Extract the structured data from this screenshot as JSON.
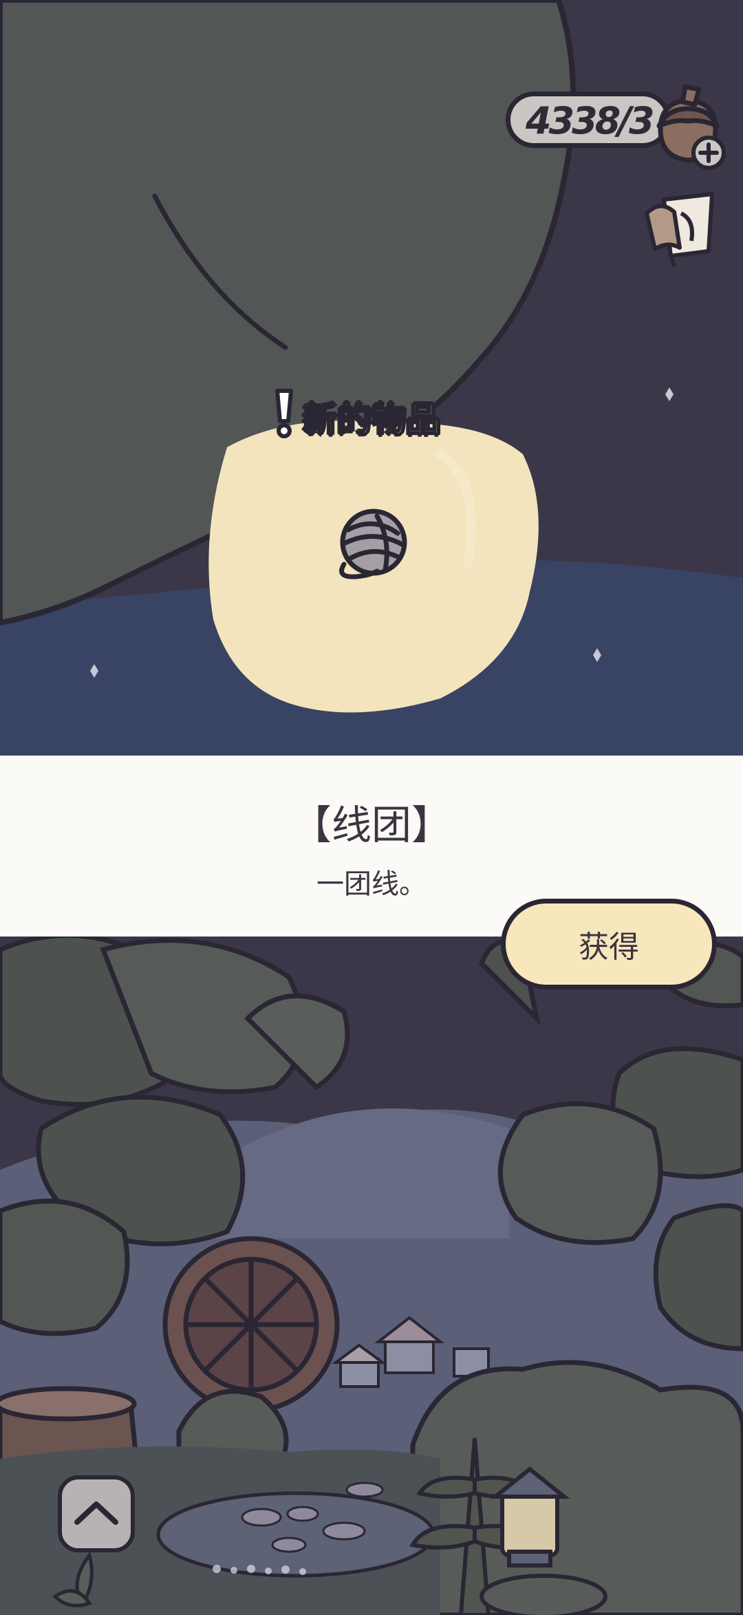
{
  "hud": {
    "currency_value": "4338/3",
    "currency_icon": "acorn-icon",
    "add_icon": "plus-icon",
    "notes_icon": "notes-icon"
  },
  "popup": {
    "badge_label": "新的物品",
    "badge_icon": "exclamation-icon",
    "item_icon": "yarn-ball-icon",
    "item_name": "【线团】",
    "item_description": "一团线。",
    "obtain_button_label": "获得"
  },
  "nav": {
    "up_button_icon": "chevron-up-icon"
  },
  "colors": {
    "night_sky": "#3b3748",
    "tree_canopy": "#525654",
    "spotlight": "#f3e4bd",
    "panel": "#fcfaf7",
    "button_fill": "#f8e6bd",
    "outline": "#2a2633"
  }
}
